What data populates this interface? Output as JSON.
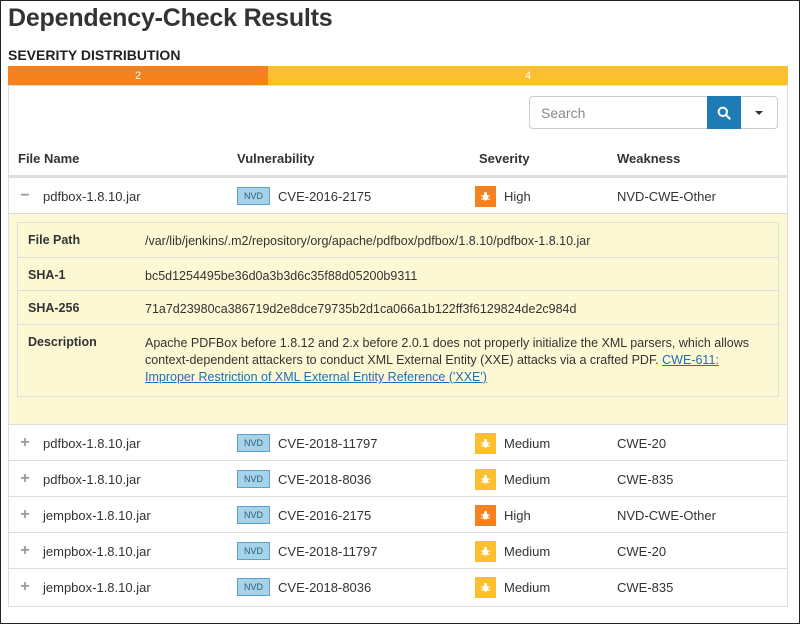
{
  "page": {
    "title": "Dependency-Check Results",
    "severity_title": "SEVERITY DISTRIBUTION"
  },
  "severity_distribution": [
    {
      "label": "2",
      "value": 2,
      "level": "High",
      "color": "#f5821f"
    },
    {
      "label": "4",
      "value": 4,
      "level": "Medium",
      "color": "#fbbf2f"
    }
  ],
  "search": {
    "placeholder": "Search",
    "value": ""
  },
  "icons": {
    "search": "search-icon",
    "dropdown": "caret-down-icon",
    "severity": "bug-icon",
    "expand": "plus-icon",
    "collapse": "minus-icon"
  },
  "colors": {
    "high": "#f5821f",
    "medium": "#fbbf2f",
    "accent": "#1f7bb6",
    "details_bg": "#fcf8d4"
  },
  "table": {
    "headers": {
      "file_name": "File Name",
      "vulnerability": "Vulnerability",
      "severity": "Severity",
      "weakness": "Weakness"
    },
    "rows": [
      {
        "toggle": "−",
        "file": "pdfbox-1.8.10.jar",
        "source": "NVD",
        "cve": "CVE-2016-2175",
        "severity": "High",
        "weakness": "NVD-CWE-Other",
        "expanded": true
      },
      {
        "toggle": "+",
        "file": "pdfbox-1.8.10.jar",
        "source": "NVD",
        "cve": "CVE-2018-11797",
        "severity": "Medium",
        "weakness": "CWE-20",
        "expanded": false
      },
      {
        "toggle": "+",
        "file": "pdfbox-1.8.10.jar",
        "source": "NVD",
        "cve": "CVE-2018-8036",
        "severity": "Medium",
        "weakness": "CWE-835",
        "expanded": false
      },
      {
        "toggle": "+",
        "file": "jempbox-1.8.10.jar",
        "source": "NVD",
        "cve": "CVE-2016-2175",
        "severity": "High",
        "weakness": "NVD-CWE-Other",
        "expanded": false
      },
      {
        "toggle": "+",
        "file": "jempbox-1.8.10.jar",
        "source": "NVD",
        "cve": "CVE-2018-11797",
        "severity": "Medium",
        "weakness": "CWE-20",
        "expanded": false
      },
      {
        "toggle": "+",
        "file": "jempbox-1.8.10.jar",
        "source": "NVD",
        "cve": "CVE-2018-8036",
        "severity": "Medium",
        "weakness": "CWE-835",
        "expanded": false
      }
    ]
  },
  "details": {
    "file_path_label": "File Path",
    "file_path": "/var/lib/jenkins/.m2/repository/org/apache/pdfbox/pdfbox/1.8.10/pdfbox-1.8.10.jar",
    "sha1_label": "SHA-1",
    "sha1": "bc5d1254495be36d0a3b3d6c35f88d05200b9311",
    "sha256_label": "SHA-256",
    "sha256": "71a7d23980ca386719d2e8dce79735b2d1ca066a1b122ff3f6129824de2c984d",
    "description_label": "Description",
    "description": "Apache PDFBox before 1.8.12 and 2.x before 2.0.1 does not properly initialize the XML parsers, which allows context-dependent attackers to conduct XML External Entity (XXE) attacks via a crafted PDF.",
    "cwe_link": "CWE-611: Improper Restriction of XML External Entity Reference ('XXE')"
  }
}
